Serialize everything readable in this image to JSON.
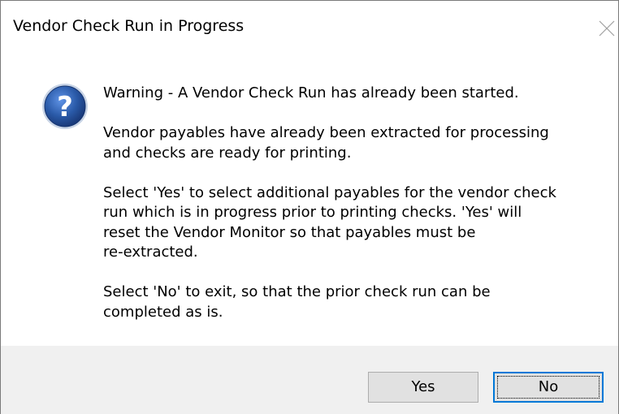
{
  "window": {
    "title": "Vendor Check Run in Progress"
  },
  "icon": "question-icon",
  "message": {
    "paragraphs": [
      "Warning - A Vendor Check Run has already been started.",
      "Vendor payables have already been extracted for processing\nand checks are ready for printing.",
      "Select 'Yes' to select additional payables for the vendor check\nrun which is in progress prior to printing checks.  'Yes' will\nreset the Vendor Monitor so that payables must be\nre-extracted.",
      "Select 'No' to exit, so that the prior check run can be\ncompleted as is."
    ]
  },
  "buttons": {
    "yes_label": "Yes",
    "no_label": "No"
  },
  "colors": {
    "icon_blue": "#2a5aa8",
    "focus_border": "#0078d7",
    "footer_bg": "#f0f0f0"
  }
}
